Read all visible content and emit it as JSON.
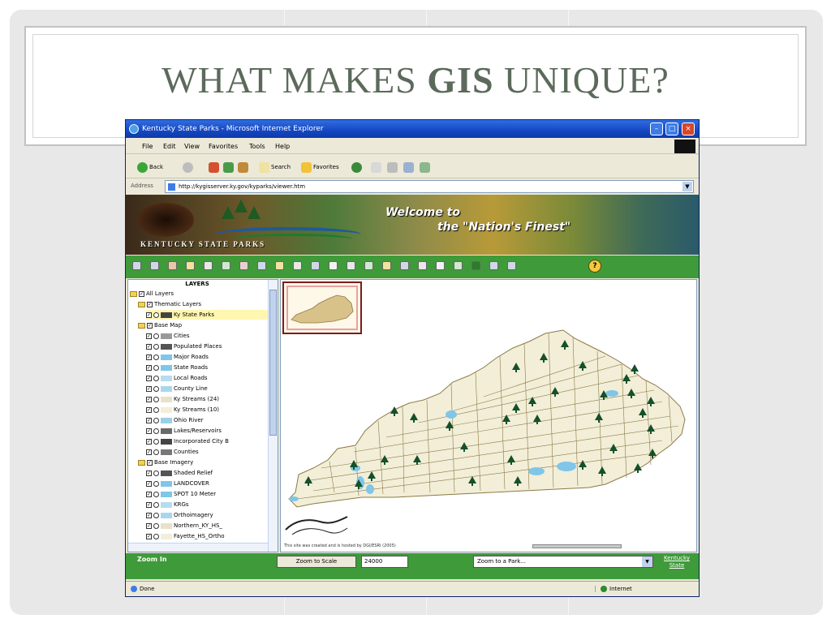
{
  "slide": {
    "title_prefix": "WHAT MAKES ",
    "title_bold": "GIS",
    "title_suffix": " UNIQUE?"
  },
  "browser": {
    "window_title": "Kentucky State Parks - Microsoft Internet Explorer",
    "menu": [
      "File",
      "Edit",
      "View",
      "Favorites",
      "Tools",
      "Help"
    ],
    "toolbar": {
      "back": "Back",
      "search": "Search",
      "favorites": "Favorites"
    },
    "address_label": "Address",
    "address_value": "http://kygisserver.ky.gov/kyparks/viewer.htm"
  },
  "banner": {
    "park_name": "KENTUCKY STATE PARKS",
    "welcome": "Welcome to",
    "tagline": "the \"Nation's Finest\""
  },
  "layers": {
    "title": "LAYERS",
    "rows": [
      {
        "label": "All Layers",
        "level": 0,
        "kind": "folder"
      },
      {
        "label": "Thematic Layers",
        "level": 1,
        "kind": "folder"
      },
      {
        "label": "Ky State Parks",
        "level": 2,
        "kind": "layer",
        "highlight": true
      },
      {
        "label": "Base Map",
        "level": 1,
        "kind": "folder"
      },
      {
        "label": "Cities",
        "level": 2,
        "kind": "layer"
      },
      {
        "label": "Populated Places",
        "level": 2,
        "kind": "layer"
      },
      {
        "label": "Major Roads",
        "level": 2,
        "kind": "layer"
      },
      {
        "label": "State Roads",
        "level": 2,
        "kind": "layer"
      },
      {
        "label": "Local Roads",
        "level": 2,
        "kind": "layer"
      },
      {
        "label": "County Line",
        "level": 2,
        "kind": "layer"
      },
      {
        "label": "Ky Streams (24)",
        "level": 2,
        "kind": "layer"
      },
      {
        "label": "Ky Streams (10)",
        "level": 2,
        "kind": "layer"
      },
      {
        "label": "Ohio River",
        "level": 2,
        "kind": "layer"
      },
      {
        "label": "Lakes/Reservoirs",
        "level": 2,
        "kind": "layer"
      },
      {
        "label": "Incorporated City B",
        "level": 2,
        "kind": "layer"
      },
      {
        "label": "Counties",
        "level": 2,
        "kind": "layer"
      },
      {
        "label": "Base Imagery",
        "level": 1,
        "kind": "folder"
      },
      {
        "label": "Shaded Relief",
        "level": 2,
        "kind": "layer"
      },
      {
        "label": "LANDCOVER",
        "level": 2,
        "kind": "layer"
      },
      {
        "label": "SPOT 10 Meter",
        "level": 2,
        "kind": "layer"
      },
      {
        "label": "KRGs",
        "level": 2,
        "kind": "layer"
      },
      {
        "label": "Orthoimagery",
        "level": 2,
        "kind": "layer"
      },
      {
        "label": "Northern_KY_HS_",
        "level": 2,
        "kind": "layer"
      },
      {
        "label": "Fayette_HS_Ortho",
        "level": 2,
        "kind": "layer"
      }
    ]
  },
  "map": {
    "credit": "This site was created and is hosted by DGI/ESRI (2005)"
  },
  "controls": {
    "zoom_in": "Zoom In",
    "zoom_scale_button": "Zoom to Scale",
    "scale_value": "24000",
    "park_select": "Zoom to a Park...",
    "ky_link": "Kentucky State"
  },
  "status": {
    "left": "Done",
    "zone": "Internet"
  },
  "colors": {
    "title": "#5b6a5b",
    "gis_green": "#3f9a3a",
    "map_fill": "#f2eed8",
    "county_line": "#8c7a46",
    "park_tree": "#14502a",
    "water": "#7fc6e8"
  }
}
